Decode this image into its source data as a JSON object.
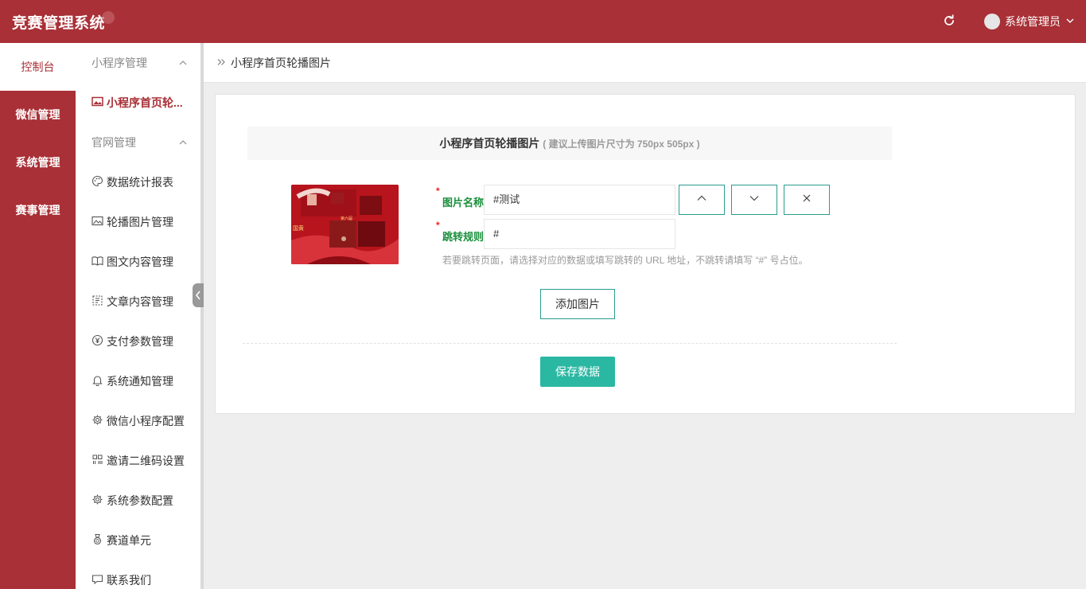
{
  "header": {
    "brand": "竞赛管理系统",
    "user_name": "系统管理员"
  },
  "primary_nav": {
    "items": [
      {
        "label": "控制台",
        "active": true
      },
      {
        "label": "微信管理"
      },
      {
        "label": "系统管理"
      },
      {
        "label": "赛事管理"
      }
    ]
  },
  "secondary_nav": {
    "group1": "小程序管理",
    "group1_items": [
      {
        "label": "小程序首页轮...",
        "icon": "image-icon",
        "active": true
      }
    ],
    "group2": "官网管理",
    "group2_items": [
      {
        "label": "数据统计报表",
        "icon": "palette-icon"
      },
      {
        "label": "轮播图片管理",
        "icon": "image-icon"
      },
      {
        "label": "图文内容管理",
        "icon": "book-icon"
      },
      {
        "label": "文章内容管理",
        "icon": "article-icon"
      },
      {
        "label": "支付参数管理",
        "icon": "yen-icon"
      },
      {
        "label": "系统通知管理",
        "icon": "bell-icon"
      },
      {
        "label": "微信小程序配置",
        "icon": "gear-icon"
      },
      {
        "label": "邀请二维码设置",
        "icon": "qrcode-icon"
      },
      {
        "label": "系统参数配置",
        "icon": "gear-icon"
      },
      {
        "label": "赛道单元",
        "icon": "medal-icon"
      },
      {
        "label": "联系我们",
        "icon": "chat-icon"
      }
    ]
  },
  "breadcrumb": {
    "label": "小程序首页轮播图片"
  },
  "panel": {
    "title": "小程序首页轮播图片",
    "hint": "( 建议上传图片尺寸为 750px 505px )",
    "name_label": "图片名称",
    "name_value": "#测试",
    "rule_label": "跳转规则",
    "rule_value": "#",
    "required_mark": "*",
    "help_text": "若要跳转页面，请选择对应的数据或填写跳转的 URL 地址，不跳转请填写 “#” 号占位。",
    "add_button": "添加图片",
    "save_button": "保存数据"
  },
  "colors": {
    "brand": "#a83036",
    "accent": "#2bb8a3",
    "label_green": "#1a8f3c"
  }
}
